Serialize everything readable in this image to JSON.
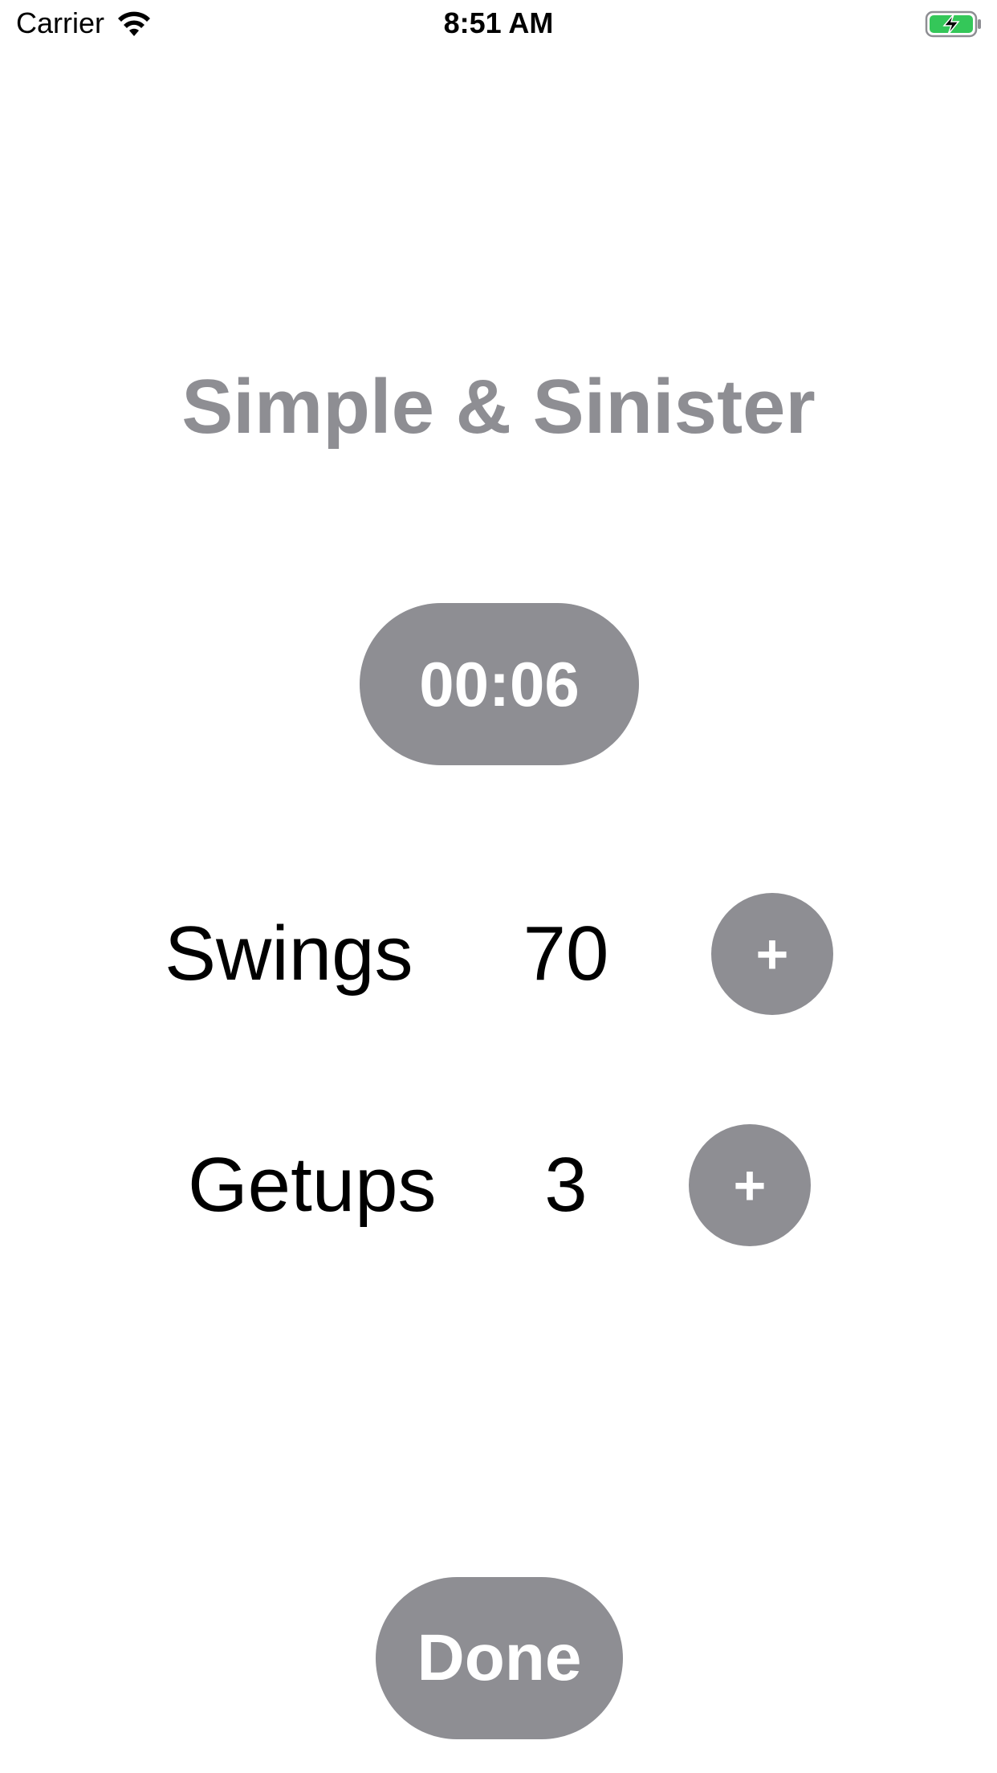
{
  "status_bar": {
    "carrier": "Carrier",
    "time": "8:51 AM",
    "wifi_icon": "wifi-icon",
    "battery_icon": "battery-charging-icon",
    "battery_color": "#34c759"
  },
  "title": "Simple & Sinister",
  "timer": {
    "value": "00:06"
  },
  "counters": [
    {
      "label": "Swings",
      "value": "70",
      "button_label": "+"
    },
    {
      "label": "Getups",
      "value": "3",
      "button_label": "+"
    }
  ],
  "done_button": {
    "label": "Done"
  },
  "colors": {
    "accent_gray": "#8e8e93",
    "text": "#000000",
    "background": "#ffffff"
  }
}
